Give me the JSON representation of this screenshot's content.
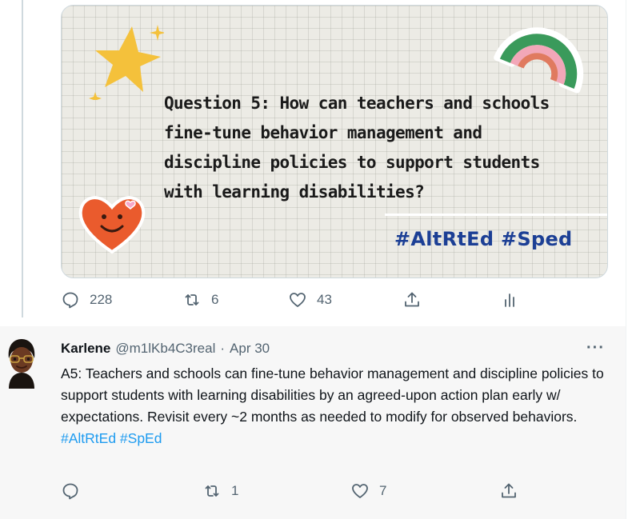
{
  "tweet": {
    "image": {
      "question_text": "Question 5: How can teachers and schools fine-tune behavior management and discipline policies to support students with learning disabilities?",
      "hashtags": "#AltRtEd #Sped",
      "colors": {
        "hashtag": "#1c3f95",
        "star": "#f4c13b",
        "heart": "#ea5b2d",
        "rainbow_outer": "#e07a5f",
        "rainbow_middle": "#f2a7b8",
        "rainbow_inner": "#3a9a5b"
      }
    },
    "actions": {
      "reply": {
        "icon": "reply-icon",
        "count": "228"
      },
      "retweet": {
        "icon": "retweet-icon",
        "count": "6"
      },
      "like": {
        "icon": "heart-icon",
        "count": "43"
      },
      "share": {
        "icon": "share-icon"
      },
      "analytics": {
        "icon": "analytics-icon"
      }
    }
  },
  "reply": {
    "author_name": "Karlene",
    "handle": "@m1lKb4C3real",
    "separator": "·",
    "date": "Apr 30",
    "more_label": "···",
    "text": "A5: Teachers and schools can fine-tune behavior management and discipline policies to support students with learning disabilities by an agreed-upon action plan early w/ expectations. Revisit every ~2 months as needed to modify for observed behaviors.",
    "hashtags": "#AltRtEd #SpEd",
    "actions": {
      "reply": {
        "icon": "reply-icon",
        "count": ""
      },
      "retweet": {
        "icon": "retweet-icon",
        "count": "1"
      },
      "like": {
        "icon": "heart-icon",
        "count": "7"
      },
      "share": {
        "icon": "share-icon"
      }
    }
  },
  "colors": {
    "link": "#1d9bf0",
    "secondary_text": "#536471",
    "reply_background": "#f7f7f7"
  }
}
